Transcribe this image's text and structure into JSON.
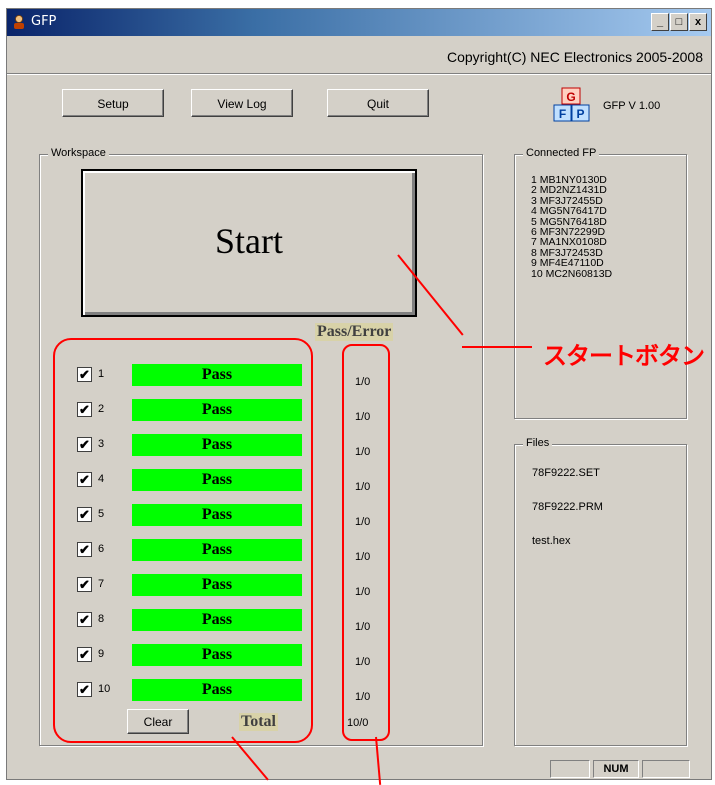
{
  "window": {
    "title": "GFP",
    "controls": {
      "minimize": "_",
      "maximize": "□",
      "close": "x"
    }
  },
  "copyright": "Copyright(C) NEC Electronics 2005-2008",
  "toolbar": {
    "setup_label": "Setup",
    "viewlog_label": "View Log",
    "quit_label": "Quit"
  },
  "logo": {
    "top_letter": "G",
    "bottom_left": "F",
    "bottom_right": "P"
  },
  "version": "GFP V 1.00",
  "workspace": {
    "label": "Workspace",
    "start_label": "Start",
    "pass_error_header": "Pass/Error",
    "rows": [
      {
        "num": "1",
        "checked": "✔",
        "status": "Pass",
        "count": "1/0"
      },
      {
        "num": "2",
        "checked": "✔",
        "status": "Pass",
        "count": "1/0"
      },
      {
        "num": "3",
        "checked": "✔",
        "status": "Pass",
        "count": "1/0"
      },
      {
        "num": "4",
        "checked": "✔",
        "status": "Pass",
        "count": "1/0"
      },
      {
        "num": "5",
        "checked": "✔",
        "status": "Pass",
        "count": "1/0"
      },
      {
        "num": "6",
        "checked": "✔",
        "status": "Pass",
        "count": "1/0"
      },
      {
        "num": "7",
        "checked": "✔",
        "status": "Pass",
        "count": "1/0"
      },
      {
        "num": "8",
        "checked": "✔",
        "status": "Pass",
        "count": "1/0"
      },
      {
        "num": "9",
        "checked": "✔",
        "status": "Pass",
        "count": "1/0"
      },
      {
        "num": "10",
        "checked": "✔",
        "status": "Pass",
        "count": "1/0"
      }
    ],
    "clear_label": "Clear",
    "total_label": "Total",
    "total_value": "10/0"
  },
  "connected_fp": {
    "label": "Connected FP",
    "items": [
      "1 MB1NY0130D",
      "2 MD2NZ1431D",
      "3 MF3J72455D",
      "4 MG5N76417D",
      "5 MG5N76418D",
      "6 MF3N72299D",
      "7 MA1NX0108D",
      "8 MF3J72453D",
      "9 MF4E47110D",
      "10 MC2N60813D"
    ]
  },
  "files": {
    "label": "Files",
    "items": [
      "78F9222.SET",
      "78F9222.PRM",
      "test.hex"
    ]
  },
  "statusbar": {
    "num_label": "NUM"
  },
  "annotation": {
    "text": "スタートボタン"
  },
  "colors": {
    "pass_green": "#00ff00",
    "annotation_red": "#ff0000",
    "titlebar_dark": "#0a246a"
  }
}
